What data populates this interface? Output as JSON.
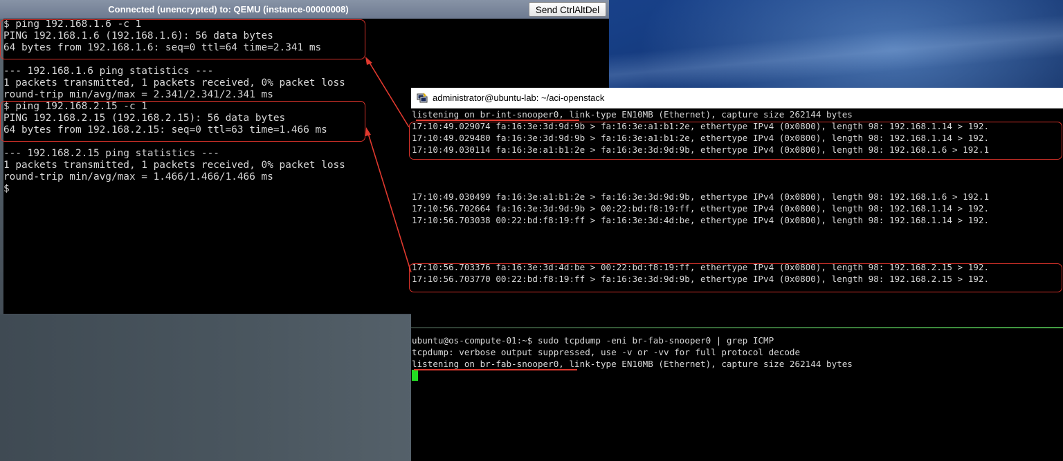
{
  "console_window": {
    "title": "Connected (unencrypted) to: QEMU (instance-00000008)",
    "send_cad_label": "Send CtrlAltDel",
    "lines": [
      "$ ping 192.168.1.6 -c 1",
      "PING 192.168.1.6 (192.168.1.6): 56 data bytes",
      "64 bytes from 192.168.1.6: seq=0 ttl=64 time=2.341 ms",
      "",
      "--- 192.168.1.6 ping statistics ---",
      "1 packets transmitted, 1 packets received, 0% packet loss",
      "round-trip min/avg/max = 2.341/2.341/2.341 ms",
      "$ ping 192.168.2.15 -c 1",
      "PING 192.168.2.15 (192.168.2.15): 56 data bytes",
      "64 bytes from 192.168.2.15: seq=0 ttl=63 time=1.466 ms",
      "",
      "--- 192.168.2.15 ping statistics ---",
      "1 packets transmitted, 1 packets received, 0% packet loss",
      "round-trip min/avg/max = 1.466/1.466/1.466 ms",
      "$"
    ]
  },
  "ssh_window": {
    "title": "administrator@ubuntu-lab: ~/aci-openstack",
    "top_pane_lines": [
      "listening on br-int-snooper0, link-type EN10MB (Ethernet), capture size 262144 bytes",
      "17:10:49.029074 fa:16:3e:3d:9d:9b > fa:16:3e:a1:b1:2e, ethertype IPv4 (0x0800), length 98: 192.168.1.14 > 192.",
      "17:10:49.029480 fa:16:3e:3d:9d:9b > fa:16:3e:a1:b1:2e, ethertype IPv4 (0x0800), length 98: 192.168.1.14 > 192.",
      "17:10:49.030114 fa:16:3e:a1:b1:2e > fa:16:3e:3d:9d:9b, ethertype IPv4 (0x0800), length 98: 192.168.1.6 > 192.1",
      "",
      "",
      "",
      "17:10:49.030499 fa:16:3e:a1:b1:2e > fa:16:3e:3d:9d:9b, ethertype IPv4 (0x0800), length 98: 192.168.1.6 > 192.1",
      "17:10:56.702664 fa:16:3e:3d:9d:9b > 00:22:bd:f8:19:ff, ethertype IPv4 (0x0800), length 98: 192.168.1.14 > 192.",
      "17:10:56.703038 00:22:bd:f8:19:ff > fa:16:3e:3d:4d:be, ethertype IPv4 (0x0800), length 98: 192.168.1.14 > 192.",
      "",
      "",
      "",
      "17:10:56.703376 fa:16:3e:3d:4d:be > 00:22:bd:f8:19:ff, ethertype IPv4 (0x0800), length 98: 192.168.2.15 > 192.",
      "17:10:56.703770 00:22:bd:f8:19:ff > fa:16:3e:3d:9d:9b, ethertype IPv4 (0x0800), length 98: 192.168.2.15 > 192."
    ],
    "bottom_pane_lines": [
      "ubuntu@os-compute-01:~$ sudo tcpdump -eni br-fab-snooper0 | grep ICMP",
      "tcpdump: verbose output suppressed, use -v or -vv for full protocol decode",
      "listening on br-fab-snooper0, link-type EN10MB (Ethernet), capture size 262144 bytes"
    ]
  },
  "colors": {
    "annotation": "#d8322a",
    "cursor": "#22dd22",
    "terminal_text": "#d8d8d8"
  },
  "icons": {
    "ssh_window_icon": "putty-terminal-icon"
  }
}
